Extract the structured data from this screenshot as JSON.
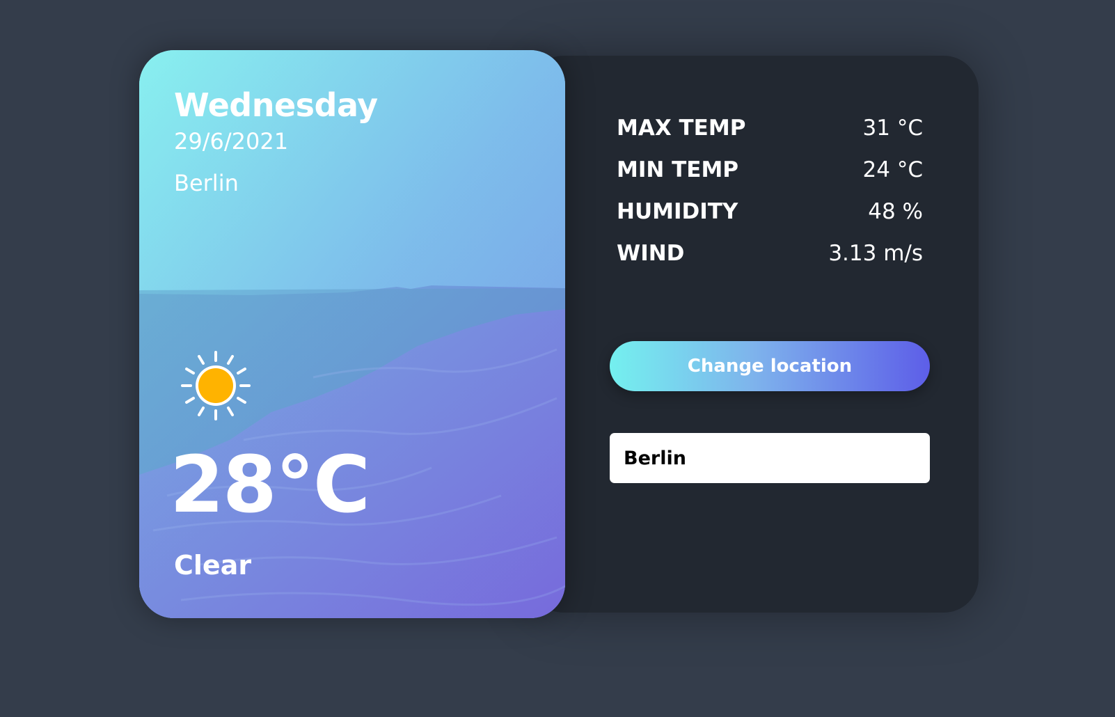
{
  "card": {
    "day": "Wednesday",
    "date": "29/6/2021",
    "location": "Berlin",
    "weather_icon": "sun-icon",
    "temperature": "28°C",
    "condition": "Clear"
  },
  "stats": {
    "max_temp": {
      "label": "MAX TEMP",
      "value": "31 °C"
    },
    "min_temp": {
      "label": "MIN TEMP",
      "value": "24 °C"
    },
    "humidity": {
      "label": "HUMIDITY",
      "value": "48 %"
    },
    "wind": {
      "label": "WIND",
      "value": "3.13 m/s"
    }
  },
  "actions": {
    "change_location_label": "Change location"
  },
  "location_input": {
    "value": "Berlin"
  },
  "colors": {
    "page_background": "#343d4b",
    "panel_background": "#222831",
    "sun": "#ffb300",
    "button_gradient_start": "#74f0ef",
    "button_gradient_end": "#5d5ee8"
  }
}
